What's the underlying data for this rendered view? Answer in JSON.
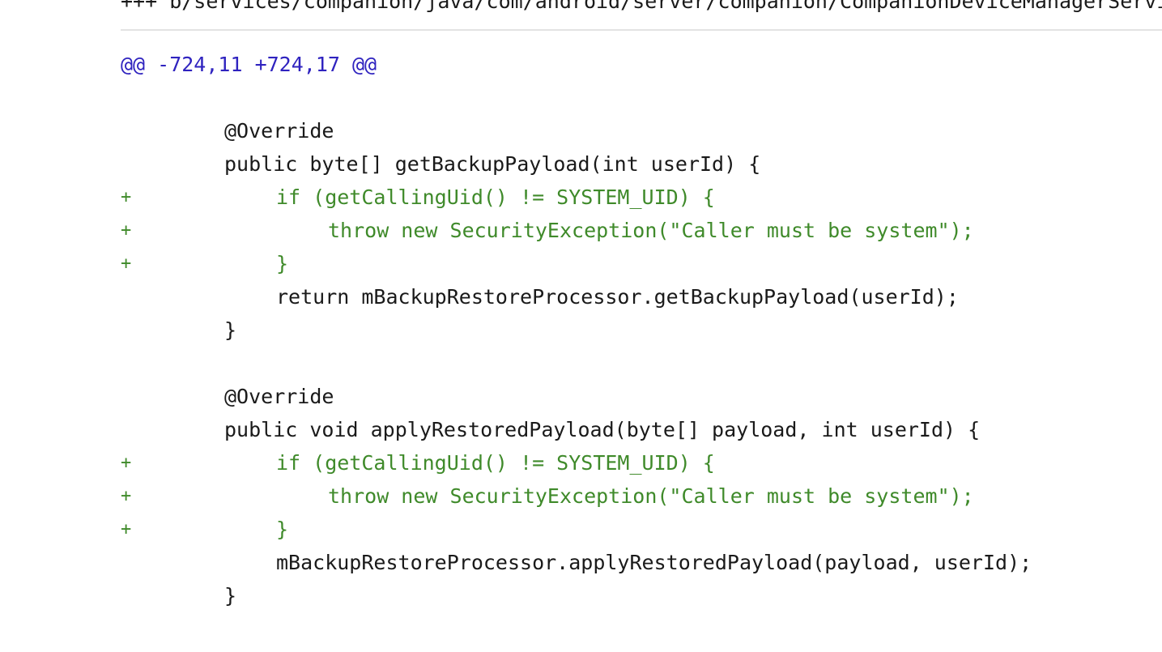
{
  "file_header": "+++ b/services/companion/java/com/android/server/companion/CompanionDeviceManagerService.java",
  "hunk_header": "@@ -724,11 +724,17 @@",
  "colors": {
    "hunk": "#2f23bf",
    "added": "#3f8a2a",
    "context": "#1a1a1a",
    "rule": "#e3e3e3"
  },
  "lines": [
    {
      "type": "context",
      "marker": "",
      "indent": 0,
      "text": ""
    },
    {
      "type": "context",
      "marker": "",
      "indent": 1,
      "text": "@Override"
    },
    {
      "type": "context",
      "marker": "",
      "indent": 1,
      "text": "public byte[] getBackupPayload(int userId) {"
    },
    {
      "type": "added",
      "marker": "+",
      "indent": 2,
      "text": "if (getCallingUid() != SYSTEM_UID) {"
    },
    {
      "type": "added",
      "marker": "+",
      "indent": 3,
      "text": "throw new SecurityException(\"Caller must be system\");"
    },
    {
      "type": "added",
      "marker": "+",
      "indent": 2,
      "text": "}"
    },
    {
      "type": "context",
      "marker": "",
      "indent": 2,
      "text": "return mBackupRestoreProcessor.getBackupPayload(userId);"
    },
    {
      "type": "context",
      "marker": "",
      "indent": 1,
      "text": "}"
    },
    {
      "type": "context",
      "marker": "",
      "indent": 0,
      "text": ""
    },
    {
      "type": "context",
      "marker": "",
      "indent": 1,
      "text": "@Override"
    },
    {
      "type": "context",
      "marker": "",
      "indent": 1,
      "text": "public void applyRestoredPayload(byte[] payload, int userId) {"
    },
    {
      "type": "added",
      "marker": "+",
      "indent": 2,
      "text": "if (getCallingUid() != SYSTEM_UID) {"
    },
    {
      "type": "added",
      "marker": "+",
      "indent": 3,
      "text": "throw new SecurityException(\"Caller must be system\");"
    },
    {
      "type": "added",
      "marker": "+",
      "indent": 2,
      "text": "}"
    },
    {
      "type": "context",
      "marker": "",
      "indent": 2,
      "text": "mBackupRestoreProcessor.applyRestoredPayload(payload, userId);"
    },
    {
      "type": "context",
      "marker": "",
      "indent": 1,
      "text": "}"
    }
  ]
}
